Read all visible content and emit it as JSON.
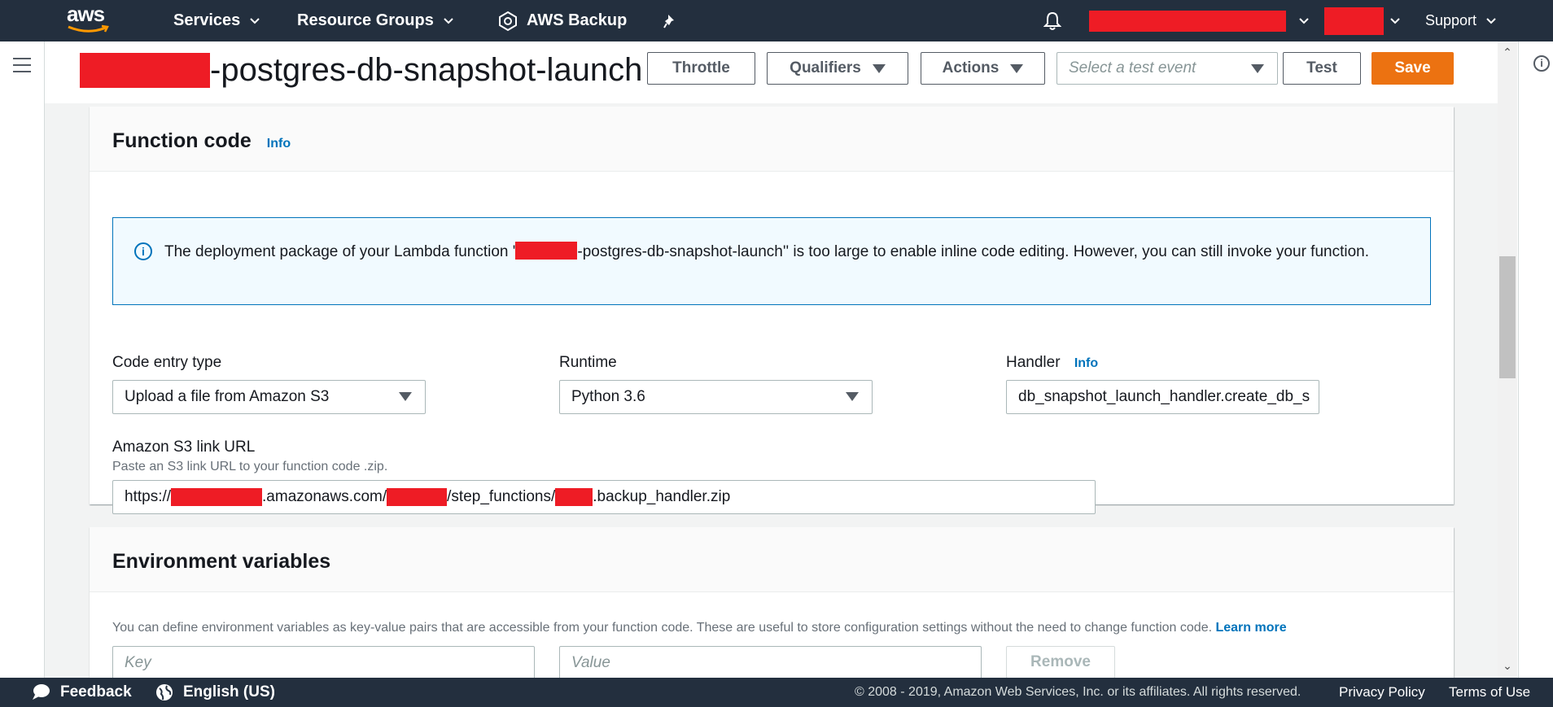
{
  "topnav": {
    "logo_text": "aws",
    "services_label": "Services",
    "resource_groups_label": "Resource Groups",
    "aws_backup_label": "AWS Backup",
    "support_label": "Support"
  },
  "header": {
    "function_title_suffix": "-postgres-db-snapshot-launch",
    "throttle_label": "Throttle",
    "qualifiers_label": "Qualifiers",
    "actions_label": "Actions",
    "test_event_placeholder": "Select a test event",
    "test_label": "Test",
    "save_label": "Save"
  },
  "function_code": {
    "title": "Function code",
    "info_label": "Info",
    "alert_prefix": "The deployment package of your Lambda function '",
    "alert_suffix": "-postgres-db-snapshot-launch'' is too large to enable inline code editing. However, you can still invoke your function.",
    "code_entry_type_label": "Code entry type",
    "code_entry_type_value": "Upload a file from Amazon S3",
    "runtime_label": "Runtime",
    "runtime_value": "Python 3.6",
    "handler_label": "Handler",
    "handler_info_label": "Info",
    "handler_value": "db_snapshot_launch_handler.create_db_s",
    "s3_label": "Amazon S3 link URL",
    "s3_desc": "Paste an S3 link URL to your function code .zip.",
    "s3_part1": "https://",
    "s3_part2": ".amazonaws.com/",
    "s3_part3": "/step_functions/",
    "s3_part4": ".backup_handler.zip"
  },
  "env_vars": {
    "title": "Environment variables",
    "description": "You can define environment variables as key-value pairs that are accessible from your function code. These are useful to store configuration settings without the need to change function code.",
    "learn_more": "Learn more",
    "key_placeholder": "Key",
    "value_placeholder": "Value",
    "remove_label": "Remove"
  },
  "footer": {
    "feedback_label": "Feedback",
    "language_label": "English (US)",
    "copyright": "© 2008 - 2019, Amazon Web Services, Inc. or its affiliates. All rights reserved.",
    "privacy_label": "Privacy Policy",
    "terms_label": "Terms of Use"
  },
  "colors": {
    "nav_bg": "#232f3e",
    "accent_orange": "#ec7211",
    "link_blue": "#0073bb",
    "redaction": "#ee1c25"
  },
  "icons": [
    "aws-logo",
    "chevron-down-icon",
    "aws-backup-icon",
    "pin-icon",
    "bell-icon",
    "hamburger-icon",
    "info-icon",
    "feedback-icon",
    "globe-icon"
  ]
}
